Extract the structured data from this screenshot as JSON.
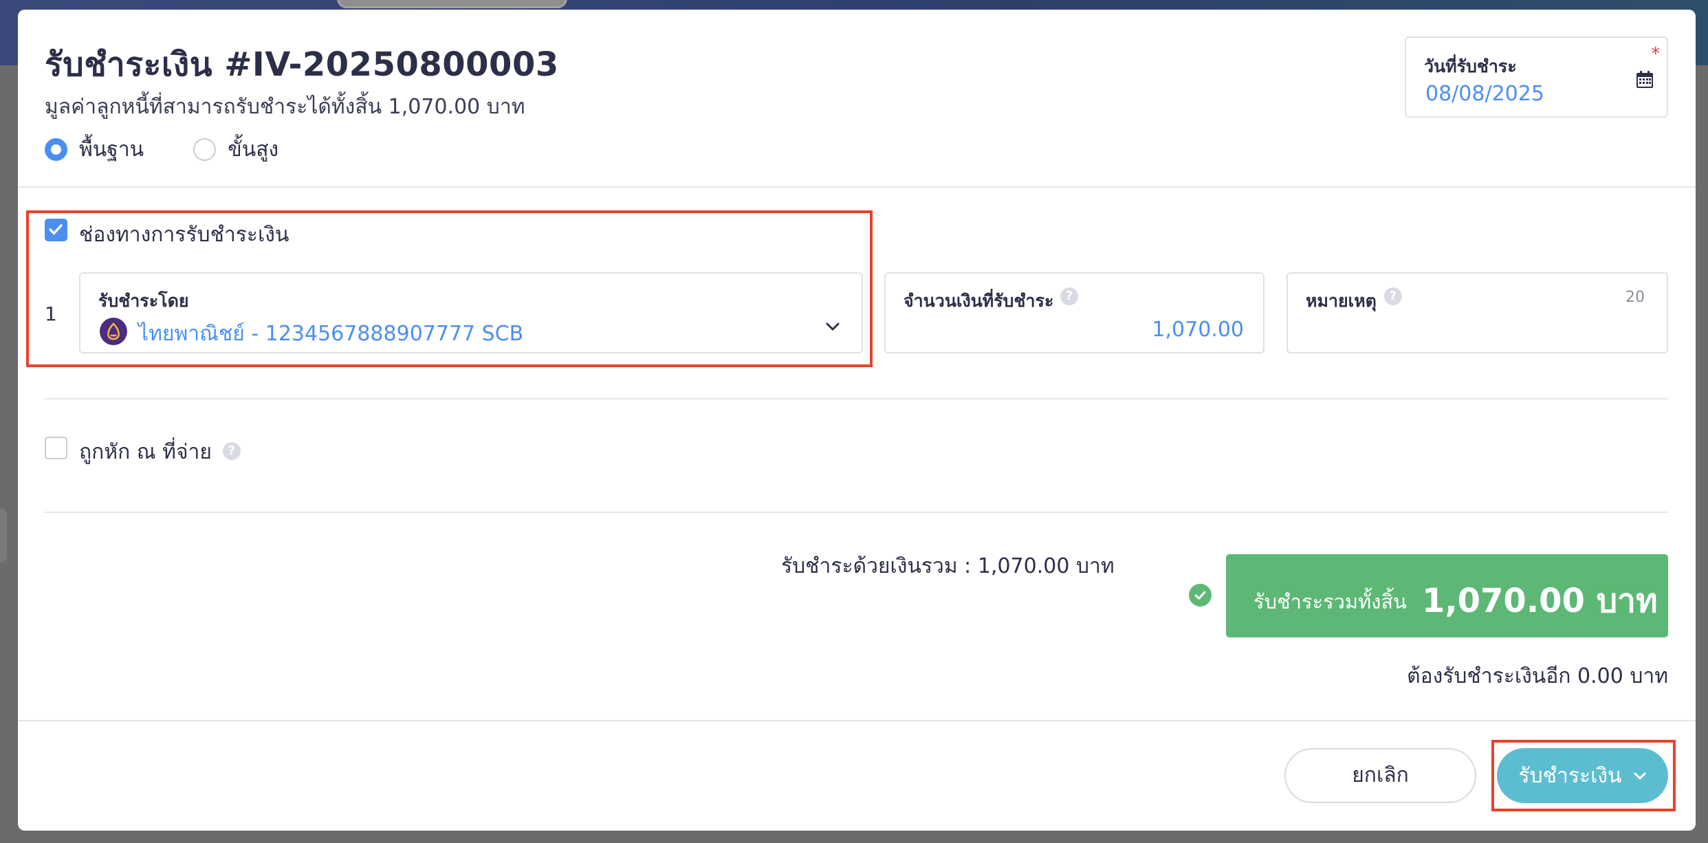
{
  "modal": {
    "title": "รับชำระเงิน #IV-20250800003",
    "subtitle": "มูลค่าลูกหนี้ที่สามารถรับชำระได้ทั้งสิ้น 1,070.00 บาท",
    "modes": [
      {
        "label": "พื้นฐาน",
        "selected": true
      },
      {
        "label": "ขั้นสูง",
        "selected": false
      }
    ]
  },
  "date": {
    "label": "วันที่รับชำระ",
    "required_mark": "*",
    "value": "08/08/2025",
    "icon": "calendar-icon"
  },
  "payment_channel": {
    "checkbox_label": "ช่องทางการรับชำระเงิน",
    "checked": true,
    "rows": [
      {
        "index": "1",
        "method_label": "รับชำระโดย",
        "method_value": "ไทยพาณิชย์ - 1234567888907777 SCB",
        "method_icon": "scb-bank-logo",
        "amount_label": "จำนวนเงินที่รับชำระ",
        "amount_value": "1,070.00",
        "note_label": "หมายเหตุ",
        "note_counter": "20"
      }
    ]
  },
  "withholding": {
    "label": "ถูกหัก ณ ที่จ่าย",
    "checked": false
  },
  "summary": {
    "paid_total_text": "รับชำระด้วยเงินรวม :  1,070.00 บาท",
    "grand_total_label": "รับชำระรวมทั้งสิ้น",
    "grand_total_amount": "1,070.00 บาท",
    "remaining_text": "ต้องรับชำระเงินอีก 0.00 บาท"
  },
  "footer": {
    "cancel_label": "ยกเลิก",
    "pay_label": "รับชำระเงิน"
  },
  "colors": {
    "accent": "#4a8ff0",
    "success": "#5cb874",
    "pay_button": "#5dbdd0",
    "highlight": "#e8412c"
  }
}
